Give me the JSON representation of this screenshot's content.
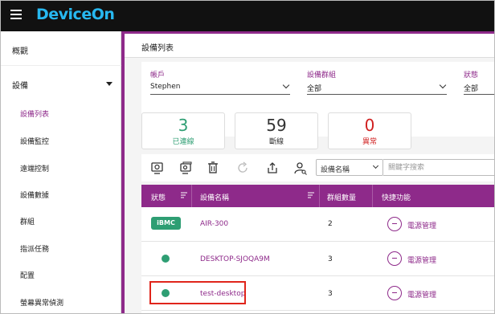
{
  "app": {
    "brand": "DeviceOn"
  },
  "sidebar": {
    "items": [
      {
        "label": "概觀"
      },
      {
        "label": "設備"
      }
    ],
    "sub_items": [
      {
        "label": "設備列表"
      },
      {
        "label": "設備監控"
      },
      {
        "label": "遠端控制"
      },
      {
        "label": "設備數據"
      },
      {
        "label": "群組"
      },
      {
        "label": "指派任務"
      },
      {
        "label": "配置"
      },
      {
        "label": "螢幕異常偵測"
      }
    ]
  },
  "page": {
    "title": "設備列表"
  },
  "filters": {
    "account": {
      "label": "帳戶",
      "value": "Stephen"
    },
    "group": {
      "label": "設備群組",
      "value": "全部"
    },
    "status": {
      "label": "狀態",
      "value": "全部"
    }
  },
  "stats": {
    "connected": {
      "value": "3",
      "label": "已連線",
      "color": "#2e9e73"
    },
    "disconnected": {
      "value": "59",
      "label": "斷線",
      "color": "#333333"
    },
    "abnormal": {
      "value": "0",
      "label": "異常",
      "color": "#d02020"
    }
  },
  "search": {
    "field_value": "設備名稱",
    "placeholder": "關鍵字搜索"
  },
  "table": {
    "headers": {
      "status": "狀態",
      "name": "設備名稱",
      "group_count": "群組數量",
      "shortcut": "快捷功能"
    },
    "rows": [
      {
        "status": "iBMC",
        "name": "AIR-300",
        "group_count": "2",
        "shortcut": "電源管理"
      },
      {
        "status": "online",
        "name": "DESKTOP-SJOQA9M",
        "group_count": "3",
        "shortcut": "電源管理"
      },
      {
        "status": "online",
        "name": "test-desktop",
        "group_count": "3",
        "shortcut": "電源管理"
      }
    ]
  },
  "colors": {
    "accent": "#8e2a8a",
    "online": "#2e9e73",
    "brand": "#27b8f0",
    "highlight": "#e0251b"
  }
}
